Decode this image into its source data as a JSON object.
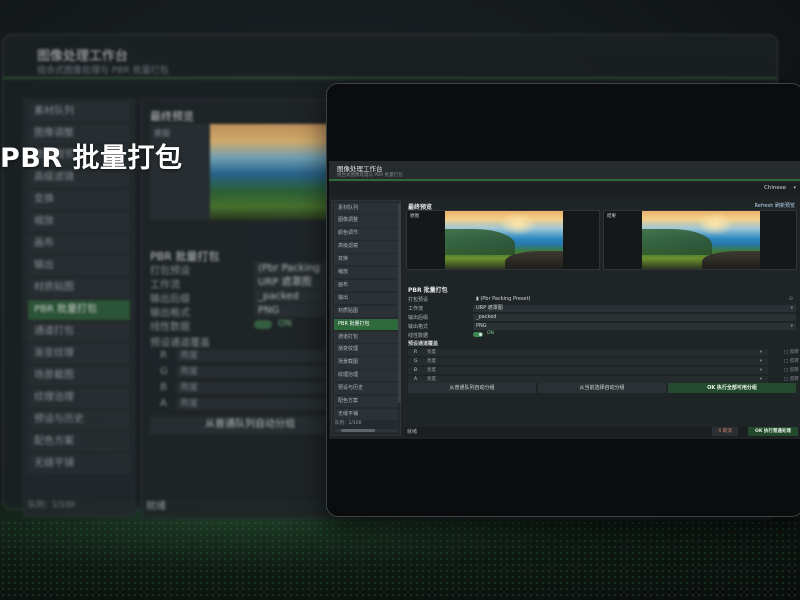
{
  "overlay_title": "PBR 批量打包",
  "app": {
    "title": "图像处理工作台",
    "subtitle": "组合式图像处理与 PBR 批量打包",
    "language": "Chinese"
  },
  "sidebar": {
    "items": [
      {
        "label": "素材队列"
      },
      {
        "label": "图像调整"
      },
      {
        "label": "颜色调节"
      },
      {
        "label": "高级滤镜"
      },
      {
        "label": "变换"
      },
      {
        "label": "缩放"
      },
      {
        "label": "画布"
      },
      {
        "label": "输出"
      },
      {
        "label": "材质贴图"
      },
      {
        "label": "PBR 批量打包"
      },
      {
        "label": "通道打包"
      },
      {
        "label": "渐变纹理"
      },
      {
        "label": "场景截图"
      },
      {
        "label": "纹理治理"
      },
      {
        "label": "预设与历史"
      },
      {
        "label": "配色方案"
      },
      {
        "label": "无缝平铺"
      }
    ],
    "active_index": 9,
    "queue_count": "队列：1/100"
  },
  "preview": {
    "title": "最终预览",
    "refresh": "Refresh 刷新预览",
    "original_label": "原图",
    "result_label": "结果"
  },
  "pbr": {
    "title": "PBR 批量打包",
    "rows": [
      {
        "label": "打包预设",
        "value": "(Pbr Packing Preset)"
      },
      {
        "label": "工作流",
        "value": "URP 遮罩图"
      },
      {
        "label": "输出后缀",
        "value": "_packed"
      },
      {
        "label": "输出格式",
        "value": "PNG"
      }
    ],
    "linear_label": "线性数据",
    "linear_state": "ON",
    "linear_value": 1,
    "channel_title": "预设通道覆盖",
    "channels": [
      {
        "name": "R",
        "value": "亮度",
        "invert": "反转"
      },
      {
        "name": "G",
        "value": "亮度",
        "invert": "反转"
      },
      {
        "name": "B",
        "value": "亮度",
        "invert": "反转"
      },
      {
        "name": "A",
        "value": "亮度",
        "invert": "反转"
      }
    ],
    "btn_auto_queue": "从普通队列自动分组",
    "btn_auto_selected": "从当前选择自动分组",
    "btn_run_all": "OK 执行全部可用分组"
  },
  "status": {
    "text": "就绪",
    "cancel": "X 取消",
    "run_normal": "OK 执行普通处理"
  }
}
